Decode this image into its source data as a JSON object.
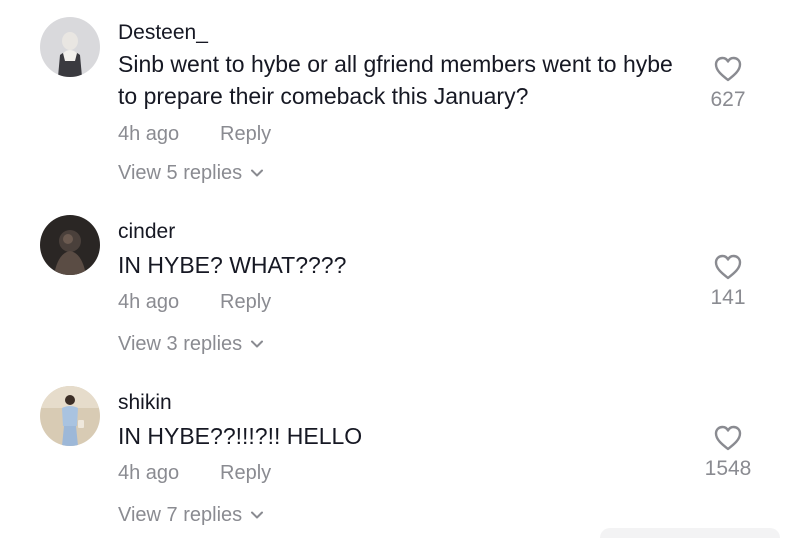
{
  "comments": [
    {
      "username": "Desteen_",
      "text": "Sinb went to hybe or all gfriend members went to hybe to prepare their comeback this January?",
      "time": "4h ago",
      "reply_label": "Reply",
      "view_replies": "View 5 replies",
      "likes": "627"
    },
    {
      "username": "cinder",
      "text": "IN HYBE? WHAT????",
      "time": "4h ago",
      "reply_label": "Reply",
      "view_replies": "View 3 replies",
      "likes": "141"
    },
    {
      "username": "shikin",
      "text": "IN HYBE??!!!?!! HELLO",
      "time": "4h ago",
      "reply_label": "Reply",
      "view_replies": "View 7 replies",
      "likes": "1548"
    }
  ],
  "icons": {
    "like": "heart-icon",
    "expand": "chevron-down-icon"
  },
  "colors": {
    "text": "#161823",
    "muted": "#8a8b91"
  }
}
